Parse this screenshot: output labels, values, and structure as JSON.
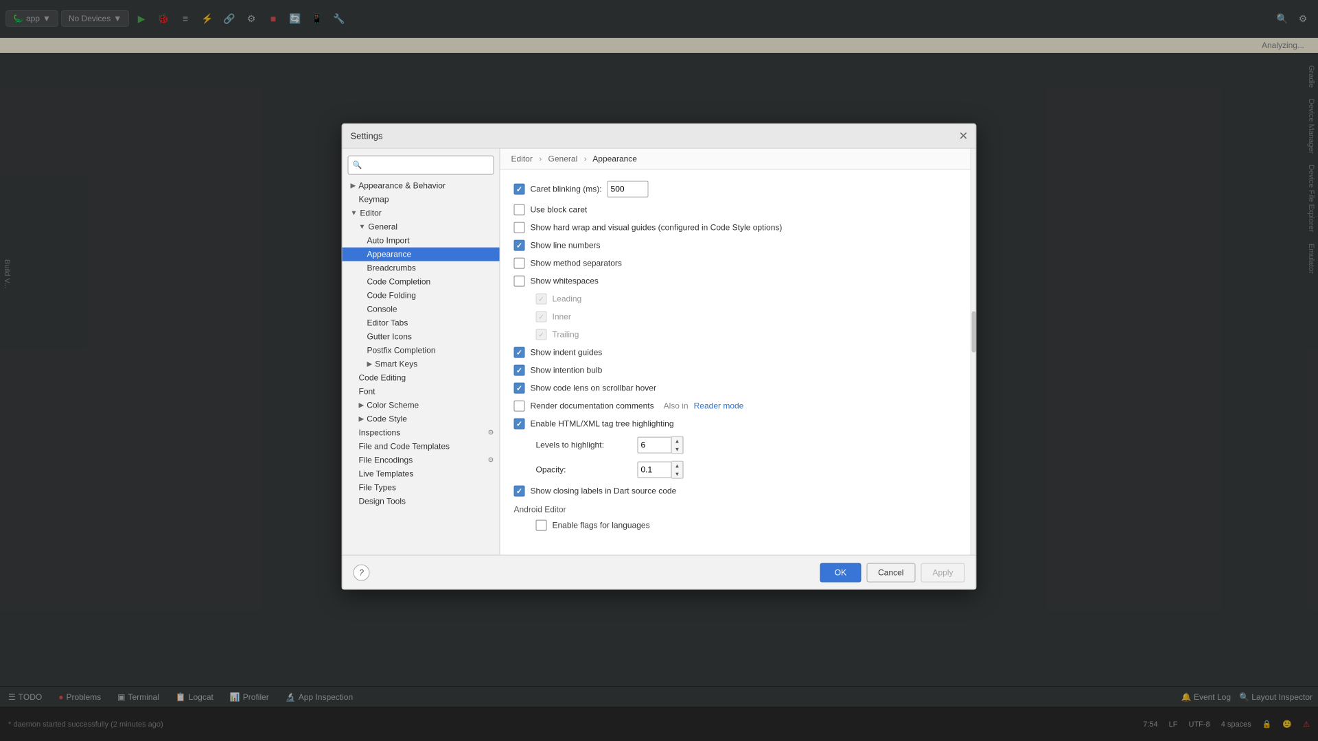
{
  "ide": {
    "app_button": "app",
    "no_devices": "No Devices",
    "analyzing": "Analyzing...",
    "side_panels": [
      "Gradle",
      "Device Manager",
      "Device File Explorer",
      "Emulator"
    ],
    "bottom_tabs": [
      "TODO",
      "Problems",
      "Terminal",
      "Logcat",
      "Profiler",
      "App Inspection"
    ],
    "bottom_right": [
      "Event Log",
      "Layout Inspector"
    ],
    "status_daemon": "* daemon started successfully (2 minutes ago)",
    "status_time": "7:54",
    "status_lf": "LF",
    "status_encoding": "UTF-8",
    "status_indent": "4 spaces"
  },
  "dialog": {
    "title": "Settings",
    "close_btn": "✕",
    "breadcrumb": {
      "parts": [
        "Editor",
        "General",
        "Appearance"
      ]
    },
    "help_btn": "?",
    "ok_btn": "OK",
    "cancel_btn": "Cancel",
    "apply_btn": "Apply"
  },
  "sidebar": {
    "search_placeholder": "🔍",
    "items": [
      {
        "label": "Appearance & Behavior",
        "level": 0,
        "expanded": true,
        "arrow": "▶"
      },
      {
        "label": "Keymap",
        "level": 1
      },
      {
        "label": "Editor",
        "level": 0,
        "expanded": true,
        "arrow": "▼"
      },
      {
        "label": "General",
        "level": 1,
        "expanded": true,
        "arrow": "▼"
      },
      {
        "label": "Auto Import",
        "level": 2
      },
      {
        "label": "Appearance",
        "level": 2,
        "selected": true
      },
      {
        "label": "Breadcrumbs",
        "level": 2
      },
      {
        "label": "Code Completion",
        "level": 2
      },
      {
        "label": "Code Folding",
        "level": 2
      },
      {
        "label": "Console",
        "level": 2
      },
      {
        "label": "Editor Tabs",
        "level": 2
      },
      {
        "label": "Gutter Icons",
        "level": 2
      },
      {
        "label": "Postfix Completion",
        "level": 2
      },
      {
        "label": "Smart Keys",
        "level": 2,
        "arrow": "▶"
      },
      {
        "label": "Code Editing",
        "level": 1
      },
      {
        "label": "Font",
        "level": 1
      },
      {
        "label": "Color Scheme",
        "level": 1,
        "arrow": "▶"
      },
      {
        "label": "Code Style",
        "level": 1,
        "arrow": "▶"
      },
      {
        "label": "Inspections",
        "level": 1,
        "has_icon": true
      },
      {
        "label": "File and Code Templates",
        "level": 1
      },
      {
        "label": "File Encodings",
        "level": 1,
        "has_icon": true
      },
      {
        "label": "Live Templates",
        "level": 1
      },
      {
        "label": "File Types",
        "level": 1
      },
      {
        "label": "Design Tools",
        "level": 1
      }
    ]
  },
  "appearance": {
    "title": "Appearance",
    "settings": [
      {
        "id": "caret_blink",
        "label": "Caret blinking (ms):",
        "checked": true,
        "type": "checkbox_input",
        "value": "500"
      },
      {
        "id": "block_caret",
        "label": "Use block caret",
        "checked": false,
        "type": "checkbox"
      },
      {
        "id": "hard_wrap",
        "label": "Show hard wrap and visual guides (configured in Code Style options)",
        "checked": false,
        "type": "checkbox"
      },
      {
        "id": "line_numbers",
        "label": "Show line numbers",
        "checked": true,
        "type": "checkbox"
      },
      {
        "id": "method_separators",
        "label": "Show method separators",
        "checked": false,
        "type": "checkbox"
      },
      {
        "id": "whitespaces",
        "label": "Show whitespaces",
        "checked": false,
        "type": "checkbox"
      },
      {
        "id": "leading",
        "label": "Leading",
        "checked": true,
        "type": "checkbox_sub",
        "disabled": true
      },
      {
        "id": "inner",
        "label": "Inner",
        "checked": true,
        "type": "checkbox_sub",
        "disabled": true
      },
      {
        "id": "trailing",
        "label": "Trailing",
        "checked": true,
        "type": "checkbox_sub",
        "disabled": true
      },
      {
        "id": "indent_guides",
        "label": "Show indent guides",
        "checked": true,
        "type": "checkbox"
      },
      {
        "id": "intention_bulb",
        "label": "Show intention bulb",
        "checked": true,
        "type": "checkbox"
      },
      {
        "id": "code_lens",
        "label": "Show code lens on scrollbar hover",
        "checked": true,
        "type": "checkbox"
      },
      {
        "id": "render_doc",
        "label": "Render documentation comments",
        "checked": false,
        "type": "checkbox_extra",
        "extra_label": "Also in",
        "extra_link": "Reader mode"
      },
      {
        "id": "html_tag_highlight",
        "label": "Enable HTML/XML tag tree highlighting",
        "checked": true,
        "type": "checkbox"
      },
      {
        "id": "levels_label",
        "label": "Levels to highlight:",
        "type": "label_spinner",
        "value": "6"
      },
      {
        "id": "opacity_label",
        "label": "Opacity:",
        "type": "label_spinner",
        "value": "0.1"
      },
      {
        "id": "closing_labels",
        "label": "Show closing labels in Dart source code",
        "checked": true,
        "type": "checkbox"
      }
    ],
    "android_editor_label": "Android Editor",
    "android_settings": [
      {
        "id": "enable_flags",
        "label": "Enable flags for languages",
        "checked": false,
        "type": "checkbox"
      }
    ]
  }
}
